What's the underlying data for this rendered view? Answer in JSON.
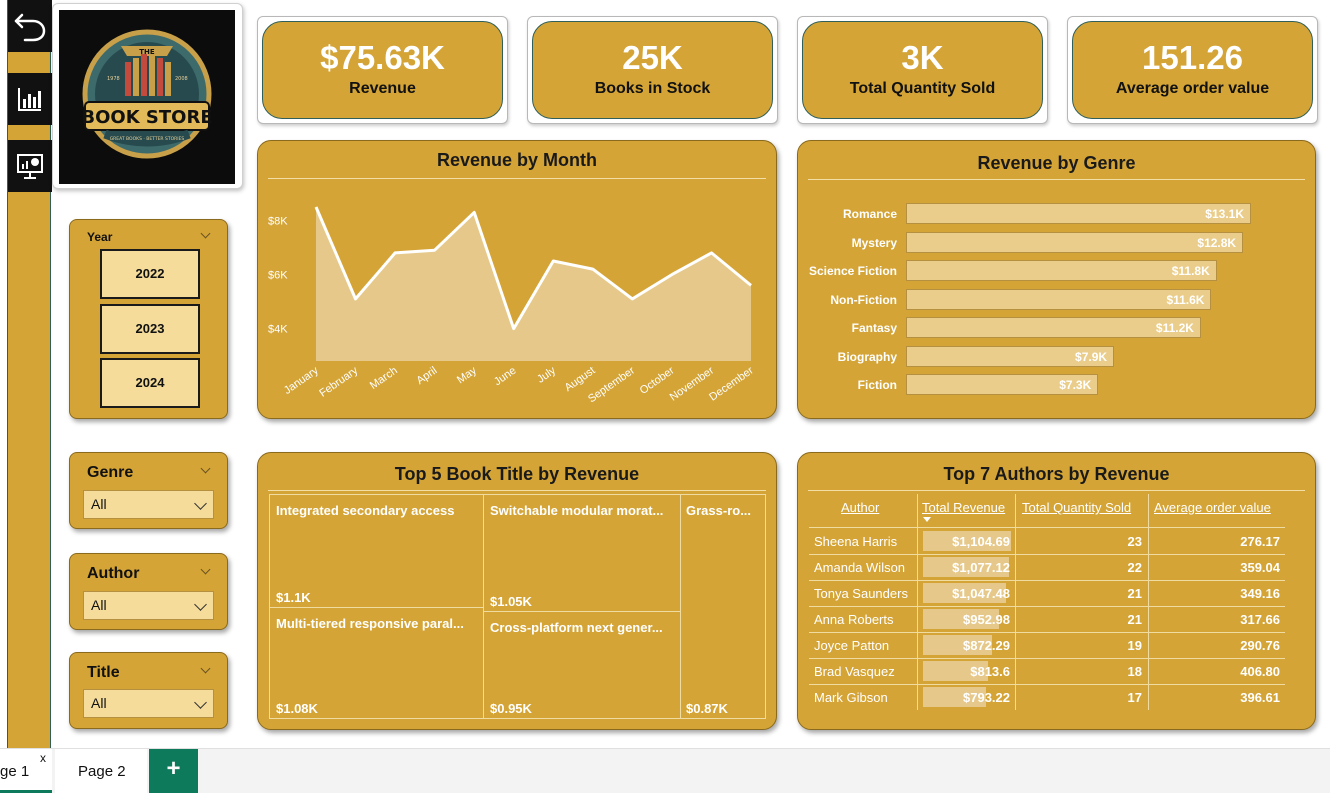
{
  "nav": {
    "back_icon": "back-arrow-icon",
    "report_icon": "bar-chart-icon",
    "presentation_icon": "presentation-icon"
  },
  "logo": {
    "top_text": "THE",
    "year_left": "1978",
    "year_right": "2008",
    "main_text": "BOOK STORE",
    "tagline": "GREAT BOOKS · BETTER STORIES"
  },
  "kpis": [
    {
      "value": "$75.63K",
      "label": "Revenue"
    },
    {
      "value": "25K",
      "label": "Books in Stock"
    },
    {
      "value": "3K",
      "label": "Total Quantity Sold"
    },
    {
      "value": "151.26",
      "label": "Average order value"
    }
  ],
  "slicers": {
    "year": {
      "title": "Year",
      "options": [
        "2022",
        "2023",
        "2024"
      ]
    },
    "genre": {
      "title": "Genre",
      "selected": "All"
    },
    "author": {
      "title": "Author",
      "selected": "All"
    },
    "title": {
      "title": "Title",
      "selected": "All"
    }
  },
  "revenue_by_month": {
    "title": "Revenue by Month",
    "chart_data": {
      "type": "area",
      "categories": [
        "January",
        "February",
        "March",
        "April",
        "May",
        "June",
        "July",
        "August",
        "September",
        "October",
        "November",
        "December"
      ],
      "values": [
        8500,
        5100,
        6800,
        6900,
        8300,
        4000,
        6500,
        6200,
        5100,
        6000,
        6800,
        5600
      ],
      "y_ticks": [
        "$4K",
        "$6K",
        "$8K"
      ],
      "ylim": [
        2800,
        9500
      ],
      "grid": false
    }
  },
  "revenue_by_genre": {
    "title": "Revenue by Genre",
    "chart_data": {
      "type": "bar",
      "orientation": "horizontal",
      "categories": [
        "Romance",
        "Mystery",
        "Science Fiction",
        "Non-Fiction",
        "Fantasy",
        "Biography",
        "Fiction"
      ],
      "values": [
        13.1,
        12.8,
        11.8,
        11.6,
        11.2,
        7.9,
        7.3
      ],
      "labels": [
        "$13.1K",
        "$12.8K",
        "$11.8K",
        "$11.6K",
        "$11.2K",
        "$7.9K",
        "$7.3K"
      ],
      "xlim": [
        0,
        13.1
      ]
    }
  },
  "top_titles": {
    "title": "Top 5 Book Title by Revenue",
    "items": [
      {
        "name": "Integrated secondary access",
        "value": "$1.1K"
      },
      {
        "name": "Multi-tiered responsive paral...",
        "value": "$1.08K"
      },
      {
        "name": "Switchable modular morat...",
        "value": "$1.05K"
      },
      {
        "name": "Cross-platform next gener...",
        "value": "$0.95K"
      },
      {
        "name": "Grass-ro...",
        "value": "$0.87K"
      }
    ]
  },
  "top_authors": {
    "title": "Top 7 Authors by Revenue",
    "columns": [
      "Author",
      "Total Revenue",
      "Total Quantity Sold",
      "Average order value"
    ],
    "rows": [
      {
        "author": "Sheena Harris",
        "revenue": "$1,104.69",
        "revenue_value": 1104.69,
        "qty": "23",
        "aov": "276.17"
      },
      {
        "author": "Amanda Wilson",
        "revenue": "$1,077.12",
        "revenue_value": 1077.12,
        "qty": "22",
        "aov": "359.04"
      },
      {
        "author": "Tonya Saunders",
        "revenue": "$1,047.48",
        "revenue_value": 1047.48,
        "qty": "21",
        "aov": "349.16"
      },
      {
        "author": "Anna Roberts",
        "revenue": "$952.98",
        "revenue_value": 952.98,
        "qty": "21",
        "aov": "317.66"
      },
      {
        "author": "Joyce Patton",
        "revenue": "$872.29",
        "revenue_value": 872.29,
        "qty": "19",
        "aov": "290.76"
      },
      {
        "author": "Brad Vasquez",
        "revenue": "$813.6",
        "revenue_value": 813.6,
        "qty": "18",
        "aov": "406.80"
      },
      {
        "author": "Mark Gibson",
        "revenue": "$793.22",
        "revenue_value": 793.22,
        "qty": "17",
        "aov": "396.61"
      }
    ]
  },
  "tabs": {
    "items": [
      "ge 1",
      "Page 2"
    ],
    "close_glyph": "x",
    "add_glyph": "+"
  },
  "colors": {
    "accent": "#d4a437",
    "panel_border": "#2f5f58",
    "add_tab": "#0e7a5c"
  }
}
